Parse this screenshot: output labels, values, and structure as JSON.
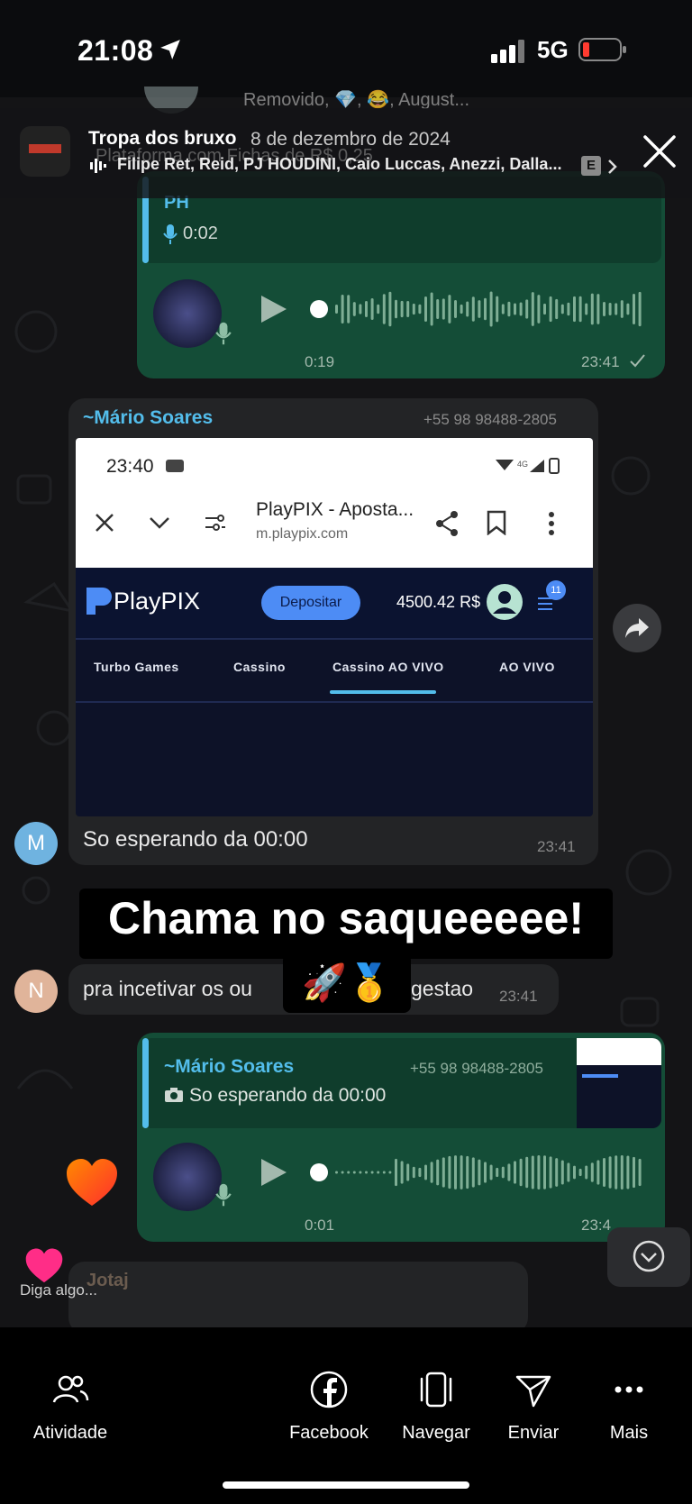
{
  "status_bar": {
    "time": "21:08",
    "network": "5G"
  },
  "story": {
    "title": "Tropa dos bruxo",
    "date": "8 de dezembro de 2024",
    "music": "Filipe Ret, Reid, PJ HOUDINI, Caio Luccas, Anezzi, Dalla...",
    "explicit_badge": "E"
  },
  "chat": {
    "top_ghost_text": "Removido, 💎, 😂, August...",
    "ghost_subtitle": "Plataforma com Fichas de R$ 0,25",
    "msg1": {
      "quote_name": "PH",
      "quote_audio": "0:02",
      "duration": "0:19",
      "time": "23:41"
    },
    "msg2": {
      "sender": "~Mário Soares",
      "phone": "+55 98 98488-2805",
      "text": "So esperando da 00:00",
      "time": "23:41",
      "avatar_letter": "M",
      "browser": {
        "time": "23:40",
        "page_title": "PlayPIX - Aposta...",
        "url": "m.playpix.com",
        "brand": "PlayPIX",
        "deposit_label": "Depositar",
        "balance": "4500.42 R$",
        "badge": "11",
        "tabs": [
          "Turbo Games",
          "Cassino",
          "Cassino AO VIVO",
          "AO VIVO"
        ]
      }
    },
    "sticker_text": "Chama no saqueeeee!",
    "sticker_emojis": "🚀🥇",
    "msg3": {
      "avatar_letter": "N",
      "text_left": "pra incetivar os ou",
      "text_right": "gestao",
      "time": "23:41"
    },
    "msg4": {
      "quote_name": "~Mário Soares",
      "quote_phone": "+55 98 98488-2805",
      "quote_text": "So esperando da 00:00",
      "duration": "0:01",
      "time": "23:4"
    },
    "msg5": {
      "sender": "Jotaj"
    },
    "reply_placeholder": "Diga algo..."
  },
  "bottom_bar": {
    "items": [
      {
        "label": "Atividade",
        "icon": "people-icon"
      },
      {
        "label": "Facebook",
        "icon": "facebook-icon"
      },
      {
        "label": "Navegar",
        "icon": "browse-icon"
      },
      {
        "label": "Enviar",
        "icon": "send-icon"
      },
      {
        "label": "Mais",
        "icon": "more-icon"
      }
    ]
  },
  "colors": {
    "bubble_out": "#144d37",
    "bubble_in": "#232426",
    "accent_blue": "#53bdeb",
    "playpix_blue": "#4d8cf5",
    "heart_red": "#ff3b30",
    "heart_pink": "#ff2d87"
  }
}
